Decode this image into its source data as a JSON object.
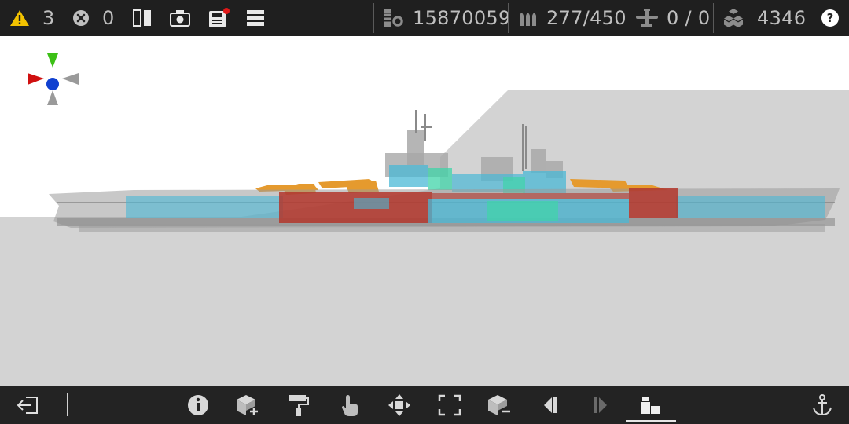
{
  "topbar": {
    "warnings_count": "3",
    "errors_count": "0",
    "cost": "15870059",
    "ammo": "277/450",
    "aircraft": "0 / 0",
    "parts": "4346",
    "icons": {
      "warning": "warning-triangle-icon",
      "error": "error-x-icon",
      "mirror": "mirror-icon",
      "camera": "camera-icon",
      "save": "save-icon",
      "menu": "menu-icon",
      "cost": "coins-icon",
      "ammo": "ammo-icon",
      "aircraft": "airplane-icon",
      "parts": "blocks-icon",
      "help": "help-icon"
    },
    "colors": {
      "warning": "#f2c200",
      "save_badge": "#e01818",
      "bar": "#1f1f1f"
    }
  },
  "bottombar": {
    "icons": [
      "exit-icon",
      "info-icon",
      "add-block-icon",
      "paint-roller-icon",
      "touch-hand-icon",
      "move-arrows-icon",
      "resize-icon",
      "remove-block-icon",
      "previous-icon",
      "next-icon",
      "structure-view-icon",
      "anchor-icon"
    ],
    "active": "structure-view-icon"
  },
  "viewport": {
    "gizmo_colors": {
      "up": "#3cc016",
      "left": "#d01010",
      "center": "#1040d0",
      "neutral": "#9a9a9a"
    },
    "hull_colors": {
      "hull": "#8f8f8f",
      "armor_red": "#b3362c",
      "orange": "#e59a2e",
      "cyan": "#4ab8d6",
      "teal": "#3fd4a8"
    }
  }
}
